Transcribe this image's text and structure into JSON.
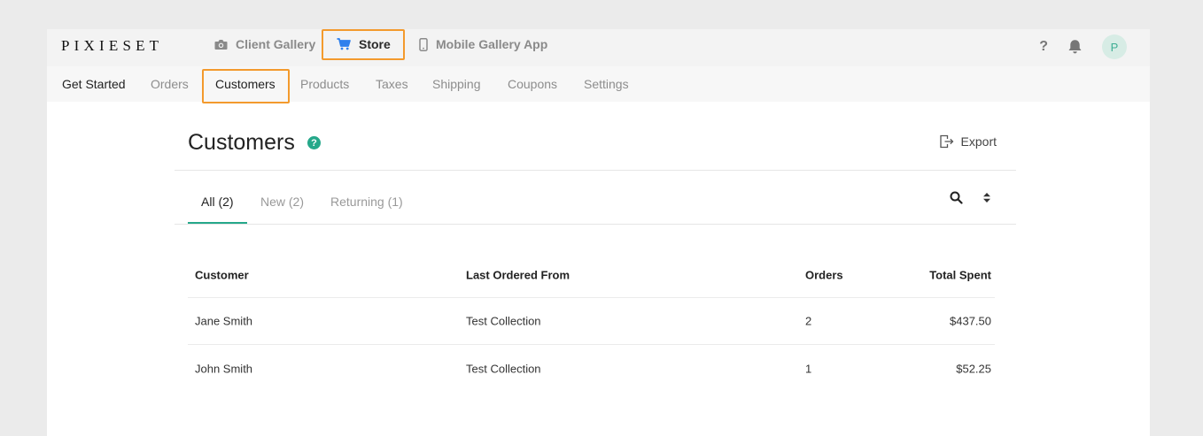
{
  "brand": {
    "logo": "PIXIESET"
  },
  "main_nav": {
    "client_gallery": "Client Gallery",
    "store": "Store",
    "mobile_app": "Mobile Gallery App"
  },
  "top_icons": {
    "help": "?",
    "avatar_letter": "P"
  },
  "sub_nav": [
    "Get Started",
    "Orders",
    "Customers",
    "Products",
    "Taxes",
    "Shipping",
    "Coupons",
    "Settings"
  ],
  "page": {
    "title": "Customers",
    "help_glyph": "?",
    "export_label": "Export"
  },
  "tabs": [
    "All (2)",
    "New (2)",
    "Returning (1)"
  ],
  "table": {
    "headers": [
      "Customer",
      "Last Ordered From",
      "Orders",
      "Total Spent"
    ],
    "rows": [
      [
        "Jane Smith",
        "Test Collection",
        "2",
        "$437.50"
      ],
      [
        "John Smith",
        "Test Collection",
        "1",
        "$52.25"
      ]
    ]
  },
  "colors": {
    "accent": "#25a88a",
    "highlight": "#f39a2d",
    "active_nav_icon": "#2f80ed"
  },
  "icons": [
    "camera-icon",
    "cart-icon",
    "phone-icon",
    "help-icon",
    "bell-icon",
    "export-icon",
    "search-icon",
    "sort-icon"
  ]
}
